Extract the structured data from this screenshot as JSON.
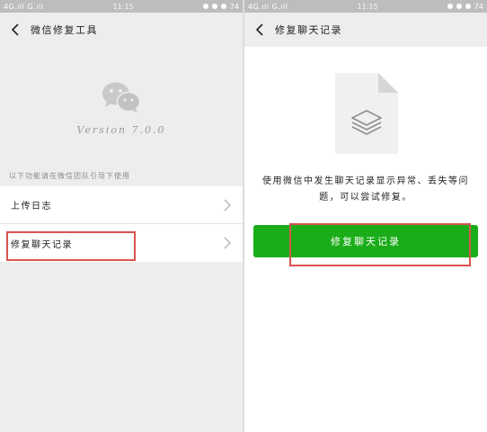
{
  "status_bar": {
    "signal": "4G.ıll G.ıll",
    "time": "11:15",
    "battery": "74"
  },
  "left": {
    "title": "微信修复工具",
    "version": "Version 7.0.0",
    "hint": "以下功能请在微信团队引导下使用",
    "items": [
      {
        "label": "上传日志"
      },
      {
        "label": "修复聊天记录"
      }
    ]
  },
  "right": {
    "title": "修复聊天记录",
    "description": "使用微信中发生聊天记录显示异常、丢失等问题，可以尝试修复。",
    "button_label": "修复聊天记录"
  },
  "colors": {
    "accent_green": "#1aad19",
    "highlight_red": "#d9534f",
    "background": "#ededed"
  },
  "icons": [
    "back-arrow-icon",
    "wechat-logo-icon",
    "chevron-right-icon",
    "document-icon",
    "layers-icon"
  ]
}
